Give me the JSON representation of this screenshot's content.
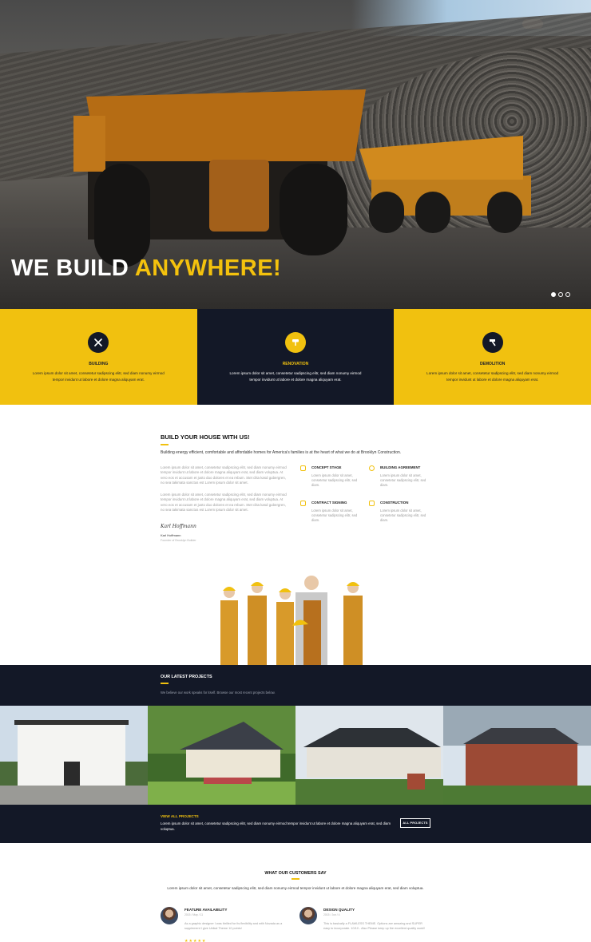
{
  "hero": {
    "title_main": "WE BUILD ",
    "title_accent": "ANYWHERE!",
    "slides": 3,
    "active_slide": 1
  },
  "services": [
    {
      "title": "BUILDING",
      "text": "Lorem ipsum dolor sit amet, consetetur sadipscing elitr, sed diam nonumy eirmod tempor invidunt ut labore et dolore magna aliquyam erat.",
      "icon": "tools-icon",
      "style": "yellow"
    },
    {
      "title": "RENOVATION",
      "text": "Lorem ipsum dolor sit amet, consetetur sadipscing elitr, sed diam nonumy eirmod tempor invidunt ut labore et dolore magna aliquyam erat.",
      "icon": "paint-roller-icon",
      "style": "dark"
    },
    {
      "title": "DEMOLITION",
      "text": "Lorem ipsum dolor sit amet, consetetur sadipscing elitr, sed diam nonumy eirmod tempor invidunt ut labore et dolore magna aliquyam erat.",
      "icon": "hammer-icon",
      "style": "yellow"
    }
  ],
  "about": {
    "heading": "BUILD YOUR HOUSE WITH US!",
    "lead": "Building energy efficient, comfortable and affordable homes for America's families is at the heart of what we do at Brooklyn Construction.",
    "paragraph1": "Lorem ipsum dolor sit amet, consetetur sadipscing elitr, sed diam nonumy eirmod tempor invidunt ut labore et dolore magna aliquyam erat, sed diam voluptua. At vero eos et accusam et justo duo dolores et ea rebum. Stet clita kasd gubergren, no sea takimata sanctus est Lorem ipsum dolor sit amet.",
    "paragraph2": "Lorem ipsum dolor sit amet, consetetur sadipscing elitr, sed diam nonumy eirmod tempor invidunt ut labore et dolore magna aliquyam erat, sed diam voluptua. At vero eos et accusam et justo duo dolores et ea rebum. Stet clita kasd gubergren, no sea takimata sanctus est Lorem ipsum dolor sit amet.",
    "signature": "Karl Hoffmann",
    "author_name": "Karl Hoffmann",
    "author_role": "Founder of Brooklyn Builder"
  },
  "features": [
    {
      "title": "CONCEPT STAGE",
      "text": "Lorem ipsum dolor sit amet, consetetur sadipscing elitr, sed diam.",
      "icon": "calculator-icon"
    },
    {
      "title": "BUILDING AGREEMENT",
      "text": "Lorem ipsum dolor sit amet, consetetur sadipscing elitr, sed diam.",
      "icon": "clock-icon"
    },
    {
      "title": "CONTRACT SIGNING",
      "text": "Lorem ipsum dolor sit amet, consetetur sadipscing elitr, sed diam.",
      "icon": "pencil-icon"
    },
    {
      "title": "CONSTRUCTION",
      "text": "Lorem ipsum dolor sit amet, consetetur sadipscing elitr, sed diam.",
      "icon": "phone-icon"
    }
  ],
  "projects": {
    "heading": "OUR LATEST PROJECTS",
    "subheading": "We believe our work speaks for itself. Browse our most recent projects below.",
    "view_all": "VIEW ALL PROJECTS",
    "description": "Lorem ipsum dolor sit amet, consetetur sadipscing elitr, sed diam nonumy eirmod tempor invidunt ut labore et dolore magna aliquyam erat, sed diam voluptua.",
    "button": "ALL PROJECTS"
  },
  "testimonials": {
    "heading": "WHAT OUR CUSTOMERS SAY",
    "subheading": "Lorem ipsum dolor sit amet, consetetur sadipscing elitr, sed diam nonumy eirmod tempor invidunt ut labore et dolore magna aliquyam erat, sed diam voluptua.",
    "reviews": [
      {
        "title": "FEATURE AVAILABILITY",
        "meta": "2015 / May / 11",
        "text": "As a graphic designer I was thrilled for its flexibility and with Novada as a supplement I give Unikal Theme 10 points!",
        "stars": "★★★★★"
      },
      {
        "title": "DESIGN QUALITY",
        "meta": "2015 / Jun / 4",
        "text": "This is basically a FLAWLESS THEME. Options are amazing and SUPER easy to incorporate. 10/10 - Also Please keep up the excellent quality work!!",
        "stars": "★★★★★"
      }
    ]
  },
  "colors": {
    "accent": "#f1c10f",
    "dark": "#131827"
  }
}
